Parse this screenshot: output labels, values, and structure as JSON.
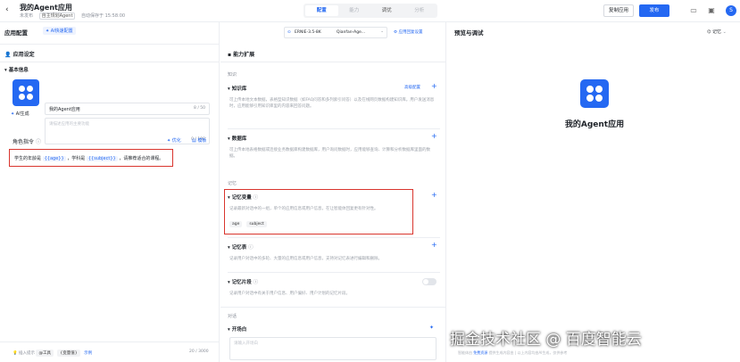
{
  "topbar": {
    "title": "我的Agent应用",
    "meta_status": "未发布",
    "meta_mode": "自主规划Agent",
    "meta_saved": "自动保存于 15:58:00",
    "tabs": [
      {
        "label": "配置"
      },
      {
        "label": "能力"
      },
      {
        "label": "调优"
      },
      {
        "label": "分析"
      }
    ],
    "copy_label": "复制应用",
    "publish_label": "发布",
    "avatar_letter": "S"
  },
  "left": {
    "header": "应用配置",
    "ai_config_label": "AI快速配置",
    "model_name": "ERNIE-3.5-8K",
    "model_secondary": "Qianfan-Age...",
    "reply_settings": "应用回复设置",
    "settings_section": "应用设定",
    "basic_info": "基本信息",
    "app_name_value": "我的Agent应用",
    "app_name_count": "8 / 50",
    "desc_placeholder": "请描述应用的主要功能",
    "desc_count": "0 / 100",
    "ai_generate": "AI生成",
    "role_title": "角色指令",
    "optimize_label": "优化",
    "template_label": "模板",
    "instruction_prefix": "学生的年龄是",
    "var_age": "{{age}}",
    "instruction_mid": "，学科是",
    "var_subject": "{{subject}}",
    "instruction_suffix": "，请推荐适合的课程。",
    "footer_hint": "插入提示",
    "footer_tool": "@工具",
    "footer_var": "{变量值}",
    "footer_link": "示例",
    "footer_count": "20 / 3000"
  },
  "mid": {
    "header": "能力扩展",
    "group_knowledge": "知识",
    "knowledge_title": "知识库",
    "knowledge_advanced": "高级配置",
    "knowledge_desc": "可上传本地文本数据，表格型知识数据（如FAQ问答和多列索引问答）以及在线网页数据构建知识库。用户发送消息时，应用能够引用知识库里的内容来回答问题。",
    "database_title": "数据库",
    "database_desc": "可上传本地表格数据或连接业务数据库构建数据库，用户询问数据时，应用能够查询、计算和分析数据库里面的数据。",
    "group_memory": "记忆",
    "memory_var_title": "记忆变量",
    "memory_var_desc": "记录最新对话中的一组，单个的应用信息或用户信息，在让智能体回复更有针对性。",
    "memory_tags": [
      "age",
      "subject"
    ],
    "memory_table_title": "记忆表",
    "memory_table_desc": "记录用户对话中的多轮、大量的应用信息或用户信息，支持对记忆表进行编辑和删除。",
    "memory_fragment_title": "记忆片段",
    "memory_fragment_desc": "记录用户对话中有关于用户信息、用户偏好、用户计划的记忆片段。",
    "group_dialog": "对话",
    "opening_title": "开场白",
    "opening_placeholder": "请输入开场白"
  },
  "right": {
    "header": "预览与调试",
    "memory_label": "记忆",
    "app_name": "我的Agent应用",
    "footer_a": "智能体由",
    "footer_link": "免费资源",
    "footer_b": "提供生成内容由",
    "footer_c": "以上内容均由AI生成，仅供参考"
  },
  "watermark": "掘金技术社区 @ 百度智能云",
  "colors": {
    "accent": "#2468f2",
    "highlight_border": "#d9352e"
  }
}
